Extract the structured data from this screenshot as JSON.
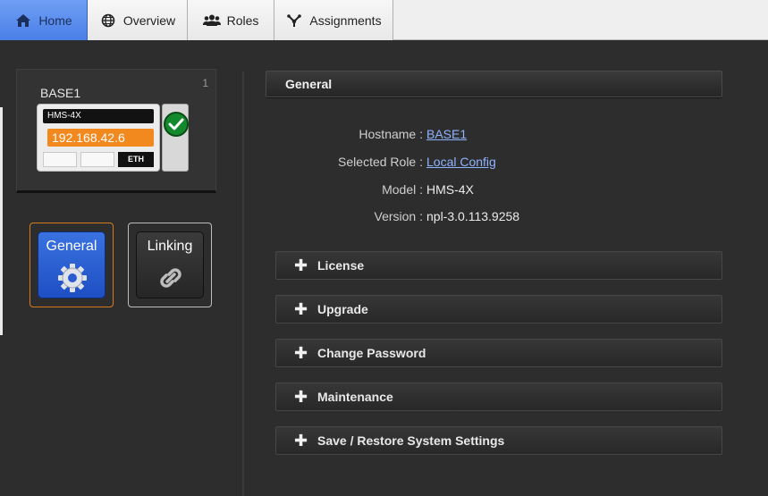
{
  "tabs": [
    {
      "label": "Home",
      "icon": "home-icon",
      "active": true
    },
    {
      "label": "Overview",
      "icon": "globe-icon",
      "active": false
    },
    {
      "label": "Roles",
      "icon": "users-icon",
      "active": false
    },
    {
      "label": "Assignments",
      "icon": "assignments-icon",
      "active": false
    }
  ],
  "device": {
    "name": "BASE1",
    "index": "1",
    "model": "HMS-4X",
    "ip": "192.168.42.6",
    "port": "ETH",
    "status_icon": "check-icon"
  },
  "nav": {
    "general_label": "General",
    "linking_label": "Linking"
  },
  "general": {
    "title": "General",
    "rows": [
      {
        "label": "Hostname :",
        "value": "BASE1"
      },
      {
        "label": "Selected Role :",
        "value": "Local Config"
      },
      {
        "label": "Model :",
        "value": "HMS-4X"
      },
      {
        "label": "Version :",
        "value": "npl-3.0.113.9258"
      }
    ]
  },
  "sections": [
    {
      "label": "License"
    },
    {
      "label": "Upgrade"
    },
    {
      "label": "Change Password"
    },
    {
      "label": "Maintenance"
    },
    {
      "label": "Save / Restore System Settings"
    }
  ],
  "colors": {
    "accent_blue": "#4a7fe6",
    "ip_orange": "#f2891f",
    "link_blue": "#8fb4ff",
    "status_green": "#128a2c"
  }
}
